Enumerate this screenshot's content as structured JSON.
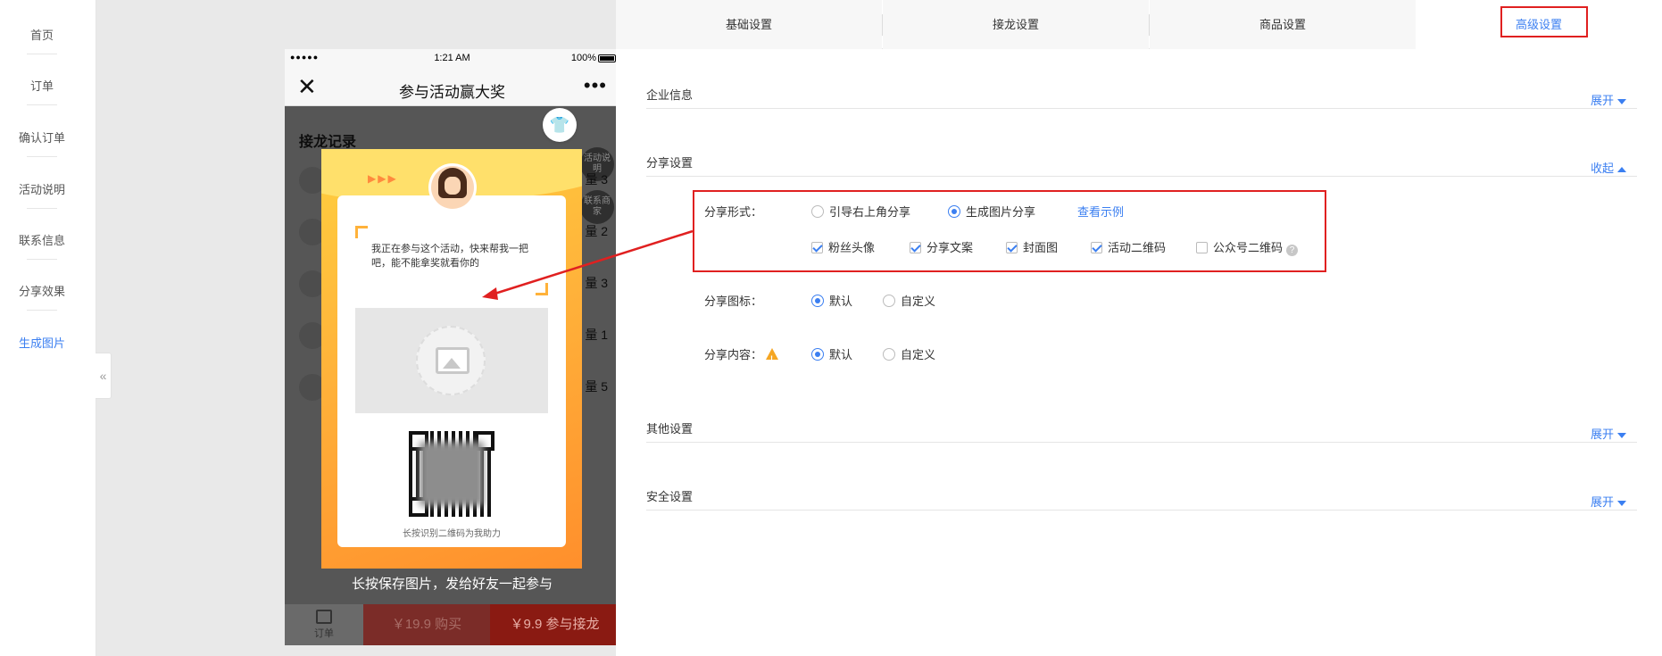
{
  "sidebar": {
    "items": [
      {
        "label": "首页"
      },
      {
        "label": "订单"
      },
      {
        "label": "确认订单"
      },
      {
        "label": "活动说明"
      },
      {
        "label": "联系信息"
      },
      {
        "label": "分享效果"
      },
      {
        "label": "生成图片"
      }
    ],
    "active_index": 6,
    "collapse_glyph": "«"
  },
  "phone": {
    "status": {
      "signal": "●●●●●",
      "time": "1:21 AM",
      "battery": "100%"
    },
    "nav": {
      "close": "✕",
      "title": "参与活动赢大奖",
      "more": "•••"
    },
    "records_title": "接龙记录",
    "fab_activity": "活动说明",
    "fab_contact": "联系商家",
    "rows": [
      {
        "qty": "量 3"
      },
      {
        "qty": "量 2"
      },
      {
        "qty": "量 3"
      },
      {
        "qty": "量 1"
      },
      {
        "qty": "量 5"
      }
    ],
    "poster": {
      "arrows": "▶▶▶",
      "message": "我正在参与这个活动，快来帮我一把吧，能不能拿奖就看你的",
      "caption": "长按识别二维码为我助力"
    },
    "save_tip": "长按保存图片，发给好友一起参与",
    "bottom": {
      "order_label": "订单",
      "buy_label": "￥19.9 购买",
      "join_label": "￥9.9 参与接龙"
    }
  },
  "shirt_icon": "shirt-icon",
  "tabs": [
    {
      "label": "基础设置"
    },
    {
      "label": "接龙设置"
    },
    {
      "label": "商品设置"
    },
    {
      "label": "高级设置"
    }
  ],
  "active_tab": 3,
  "sections": {
    "enterprise": {
      "title": "企业信息",
      "toggle": "展开"
    },
    "share": {
      "title": "分享设置",
      "toggle": "收起"
    },
    "other": {
      "title": "其他设置",
      "toggle": "展开"
    },
    "security": {
      "title": "安全设置",
      "toggle": "展开"
    }
  },
  "share_form": {
    "form_label": "分享形式：",
    "form_options": [
      {
        "label": "引导右上角分享",
        "selected": false
      },
      {
        "label": "生成图片分享",
        "selected": true
      }
    ],
    "view_example": "查看示例",
    "checkboxes": [
      {
        "label": "粉丝头像",
        "checked": true
      },
      {
        "label": "分享文案",
        "checked": true
      },
      {
        "label": "封面图",
        "checked": true
      },
      {
        "label": "活动二维码",
        "checked": true
      },
      {
        "label": "公众号二维码",
        "checked": false
      }
    ],
    "help_glyph": "?",
    "icon_label": "分享图标：",
    "icon_options": [
      {
        "label": "默认",
        "selected": true
      },
      {
        "label": "自定义",
        "selected": false
      }
    ],
    "content_label": "分享内容：",
    "content_options": [
      {
        "label": "默认",
        "selected": true
      },
      {
        "label": "自定义",
        "selected": false
      }
    ],
    "warn_glyph": "!"
  },
  "colors": {
    "accent": "#3b7ff1",
    "annotation_red": "#e02020",
    "poster_orange": "#ffb23a"
  }
}
